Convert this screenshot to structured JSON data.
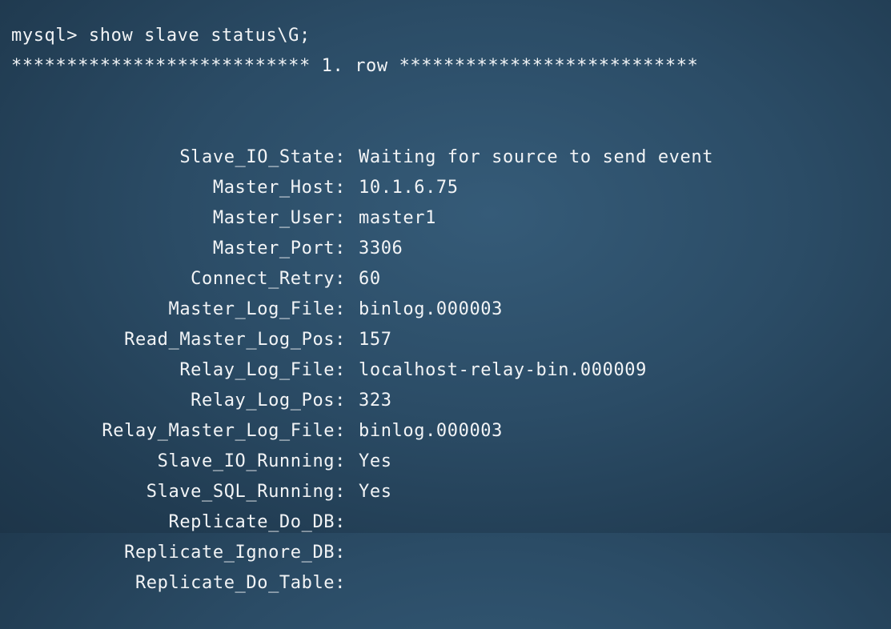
{
  "terminal": {
    "prompt": "mysql> show slave status\\G;",
    "row_header": "*************************** 1. row ***************************",
    "fields": [
      {
        "name": "Slave_IO_State:",
        "value": "Waiting for source to send event"
      },
      {
        "name": "Master_Host:",
        "value": "10.1.6.75"
      },
      {
        "name": "Master_User:",
        "value": "master1"
      },
      {
        "name": "Master_Port:",
        "value": "3306"
      },
      {
        "name": "Connect_Retry:",
        "value": "60"
      },
      {
        "name": "Master_Log_File:",
        "value": "binlog.000003"
      },
      {
        "name": "Read_Master_Log_Pos:",
        "value": "157"
      },
      {
        "name": "Relay_Log_File:",
        "value": "localhost-relay-bin.000009"
      },
      {
        "name": "Relay_Log_Pos:",
        "value": "323"
      },
      {
        "name": "Relay_Master_Log_File:",
        "value": "binlog.000003"
      },
      {
        "name": "Slave_IO_Running:",
        "value": "Yes"
      },
      {
        "name": "Slave_SQL_Running:",
        "value": "Yes"
      },
      {
        "name": "Replicate_Do_DB:",
        "value": ""
      },
      {
        "name": "Replicate_Ignore_DB:",
        "value": ""
      },
      {
        "name": "Replicate_Do_Table:",
        "value": ""
      }
    ]
  }
}
